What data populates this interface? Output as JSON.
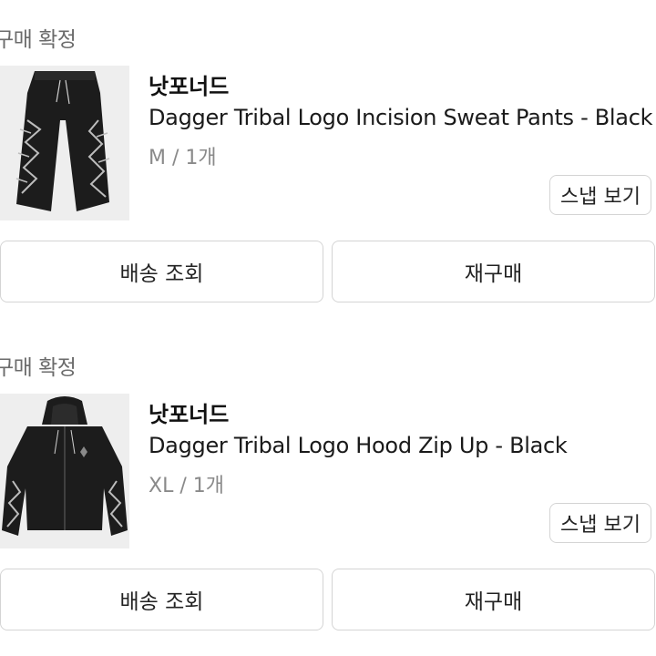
{
  "orders": [
    {
      "status": "구매 확정",
      "brand": "낫포너드",
      "product_name": "Dagger Tribal Logo Incision Sweat Pants - Black",
      "option": "M / 1개",
      "snap_label": "스냅 보기",
      "track_label": "배송 조회",
      "reorder_label": "재구매",
      "thumbnail_icon": "pants-image"
    },
    {
      "status": "구매 확정",
      "brand": "낫포너드",
      "product_name": "Dagger Tribal Logo Hood Zip Up - Black",
      "option": "XL / 1개",
      "snap_label": "스냅 보기",
      "track_label": "배송 조회",
      "reorder_label": "재구매",
      "thumbnail_icon": "hoodie-image"
    }
  ]
}
